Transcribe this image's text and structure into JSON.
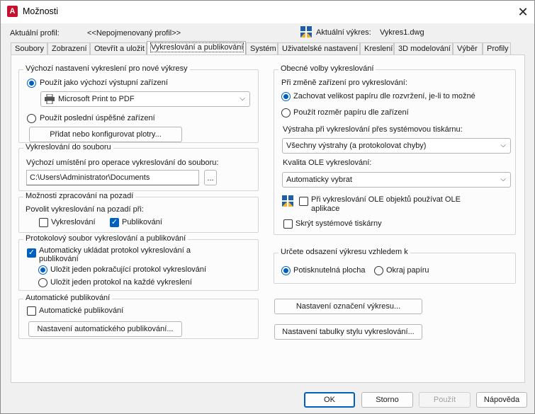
{
  "window": {
    "title": "Možnosti",
    "app_icon_letter": "A"
  },
  "profile": {
    "label": "Aktuální profil:",
    "value": "<<Nepojmenovaný profil>>",
    "drawing_label": "Aktuální výkres:",
    "drawing_value": "Vykres1.dwg"
  },
  "tabs": [
    {
      "label": "Soubory"
    },
    {
      "label": "Zobrazení"
    },
    {
      "label": "Otevřít a uložit"
    },
    {
      "label": "Vykreslování a publikování"
    },
    {
      "label": "Systém"
    },
    {
      "label": "Uživatelské nastavení"
    },
    {
      "label": "Kreslení"
    },
    {
      "label": "3D modelování"
    },
    {
      "label": "Výběr"
    },
    {
      "label": "Profily"
    }
  ],
  "default_output": {
    "title": "Výchozí nastavení vykreslení pro nové výkresy",
    "use_default_label": "Použít jako výchozí výstupní zařízení",
    "device": "Microsoft Print to PDF",
    "use_last_label": "Použít poslední úspěšné zařízení",
    "add_plotters_button": "Přidat nebo konfigurovat plotry..."
  },
  "plot_to_file": {
    "title": "Vykreslování do souboru",
    "location_label": "Výchozí umístění pro operace vykreslování do souboru:",
    "location_value": "C:\\Users\\Administrator\\Documents",
    "browse_button": "..."
  },
  "background": {
    "title": "Možnosti zpracování na pozadí",
    "enable_label": "Povolit vykreslování na pozadí při:",
    "plotting_label": "Vykreslování",
    "publishing_label": "Publikování"
  },
  "log": {
    "title": "Protokolový soubor vykreslování a publikování",
    "auto_save_label_line1": "Automaticky ukládat protokol vykreslování a",
    "auto_save_label_line2": "publikování",
    "continuous_label": "Uložit jeden pokračující protokol vykreslování",
    "per_plot_label": "Uložit jeden protokol na každé vykreslení"
  },
  "auto_publish": {
    "title": "Automatické publikování",
    "checkbox_label": "Automatické publikování",
    "settings_button": "Nastavení automatického publikování..."
  },
  "general": {
    "title": "Obecné volby vykreslování",
    "device_change_label": "Při změně zařízení pro vykreslování:",
    "keep_size_label": "Zachovat velikost papíru dle rozvržení, je-li to možné",
    "use_device_size_label": "Použít rozměr papíru dle zařízení",
    "spooler_label": "Výstraha při vykreslování přes systémovou tiskárnu:",
    "spooler_value": "Všechny výstrahy (a protokolovat chyby)",
    "ole_quality_label": "Kvalita OLE vykreslování:",
    "ole_quality_value": "Automaticky vybrat",
    "ole_app_label_line1": "Při vykreslování OLE objektů používat OLE",
    "ole_app_label_line2": "aplikace",
    "hide_printers_label": "Skrýt systémové tiskárny"
  },
  "offset": {
    "title": "Určete odsazení výkresu vzhledem k",
    "printable_label": "Potisknutelná plocha",
    "paper_edge_label": "Okraj papíru"
  },
  "stamp_button": "Nastavení označení výkresu...",
  "style_table_button": "Nastavení tabulky stylu vykreslování...",
  "dialog_buttons": {
    "ok": "OK",
    "cancel": "Storno",
    "apply": "Použít",
    "help": "Nápověda"
  },
  "colors": {
    "accent": "#0060c0",
    "app_red": "#c8102e"
  }
}
